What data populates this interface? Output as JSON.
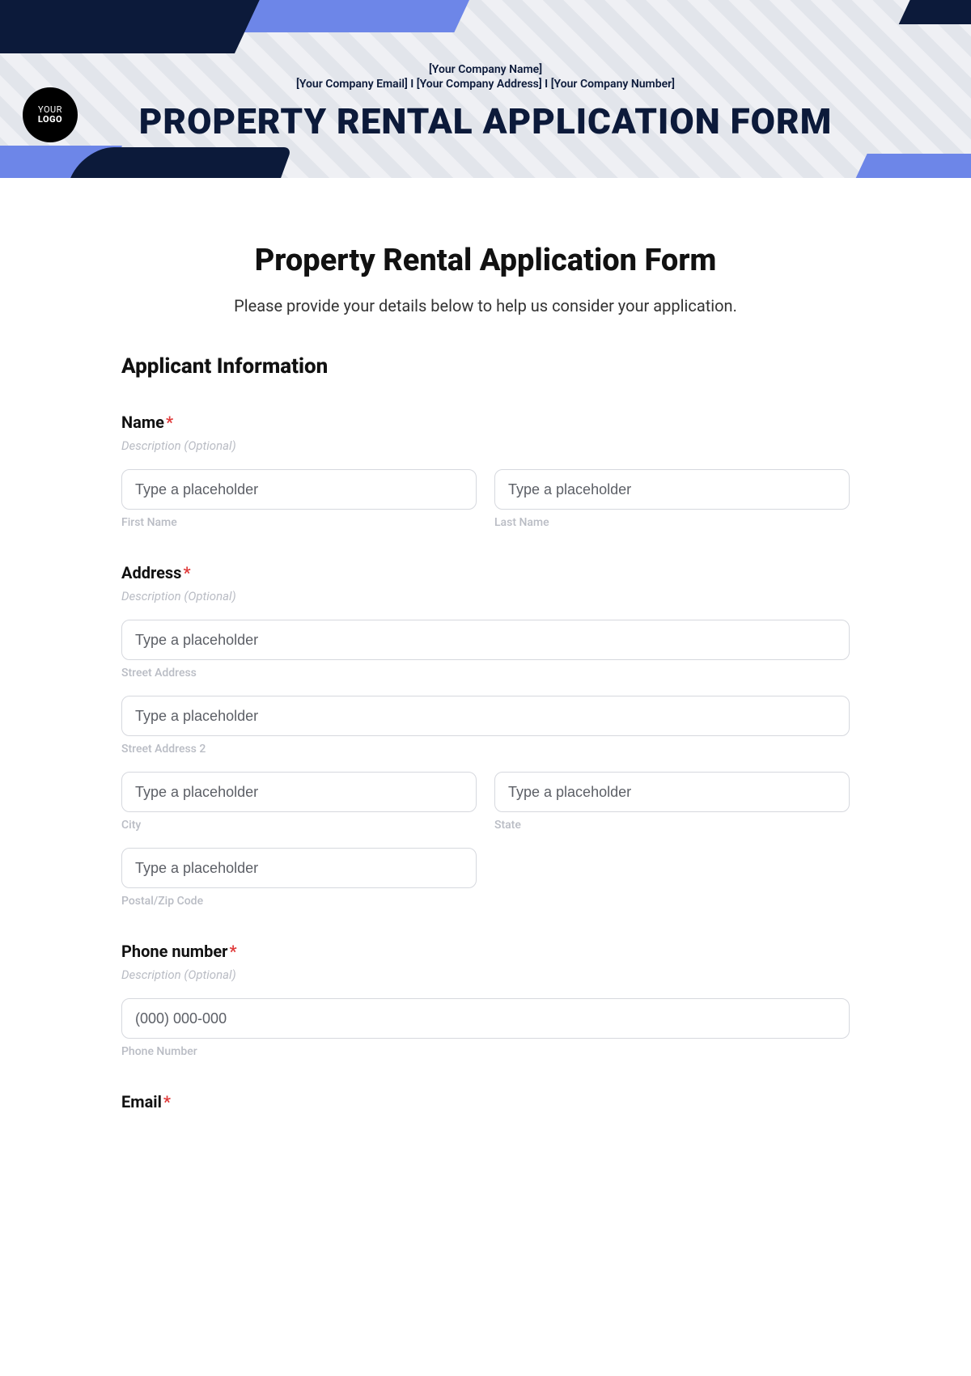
{
  "banner": {
    "company_name": "[Your Company Name]",
    "company_line2": "[Your Company Email] I [Your Company Address] I [Your Company Number]",
    "title": "PROPERTY RENTAL APPLICATION FORM",
    "logo_top": "YOUR",
    "logo_bottom": "LOGO"
  },
  "form": {
    "title": "Property Rental Application Form",
    "subtitle": "Please provide your details below to help us consider your application.",
    "section_applicant": "Applicant Information",
    "desc_placeholder": "Description (Optional)",
    "generic_placeholder": "Type a placeholder",
    "name": {
      "label": "Name",
      "first_sub": "First Name",
      "last_sub": "Last Name"
    },
    "address": {
      "label": "Address",
      "street_sub": "Street Address",
      "street2_sub": "Street Address 2",
      "city_sub": "City",
      "state_sub": "State",
      "postal_sub": "Postal/Zip Code"
    },
    "phone": {
      "label": "Phone number",
      "placeholder": "(000) 000-000",
      "sub": "Phone Number"
    },
    "email": {
      "label": "Email"
    }
  }
}
